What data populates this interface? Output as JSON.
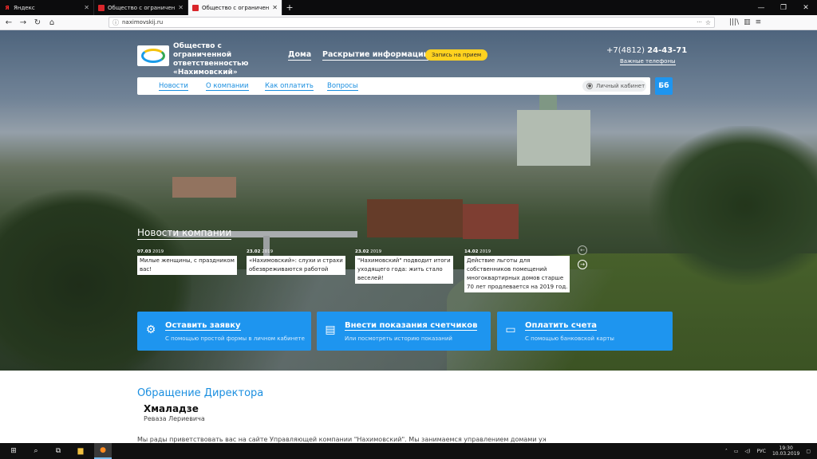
{
  "browser": {
    "tabs": [
      {
        "label": "Яндекс",
        "favicon": "yandex-favicon"
      },
      {
        "label": "Общество с ограниченной от…",
        "favicon": "company-favicon"
      },
      {
        "label": "Общество с ограниченной от…",
        "favicon": "company-favicon",
        "active": true
      }
    ],
    "url": "naximovskij.ru",
    "url_dots": "···"
  },
  "header": {
    "org_name": "Общество с ограниченной ответственностью «Нахимовский»",
    "nav_home": "Дома",
    "nav_disclosure": "Раскрытие информации",
    "appointment_button": "Запись на прием",
    "phone_prefix": "+7(4812) ",
    "phone_number": "24-43-71",
    "important_phones": "Важные телефоны"
  },
  "menu": {
    "items": [
      "Новости",
      "О компании",
      "Как оплатить",
      "Вопросы"
    ],
    "cabinet": "Личный кабинет",
    "accessibility_icon": "glasses-icon",
    "accessibility_label": "Бб"
  },
  "news": {
    "title": "Новости компании",
    "items": [
      {
        "date": "07.03",
        "year": "2019",
        "lines": [
          "Милые женщины, с праздником",
          "вас!"
        ]
      },
      {
        "date": "23.02",
        "year": "2019",
        "lines": [
          "«Нахимовский»: слухи и страхи",
          "обезвреживаются работой"
        ]
      },
      {
        "date": "23.02",
        "year": "2019",
        "lines": [
          "\"Нахимовский\" подводит итоги",
          "уходящего года: жить стало",
          "веселей!"
        ]
      },
      {
        "date": "14.02",
        "year": "2019",
        "lines": [
          "Действие льготы для",
          "собственников помещений",
          "многоквартирных домов старше",
          "70 лет продлевается на 2019 год."
        ]
      }
    ]
  },
  "actions": [
    {
      "title": "Оставить заявку",
      "subtitle": "С помощью простой формы в личном кабинете",
      "icon": "request-icon"
    },
    {
      "title": "Внести показания счетчиков",
      "subtitle": "Или посмотреть историю показаний",
      "icon": "meter-icon"
    },
    {
      "title": "Оплатить счета",
      "subtitle": "С помощью банковской карты",
      "icon": "payment-icon"
    }
  ],
  "director": {
    "title": "Обращение Директора",
    "surname": "Хмаладзе",
    "name": "Реваза Лериевича",
    "welcome_text": "Мы рады приветствовать вас на сайте Управляющей компании \"Нахимовский\". Мы занимаемся управлением домами уже не"
  },
  "taskbar": {
    "language": "РУС",
    "time": "19:30",
    "date": "10.03.2019"
  },
  "colors": {
    "accent_blue": "#1e95ef",
    "button_yellow": "#ffd21f"
  }
}
